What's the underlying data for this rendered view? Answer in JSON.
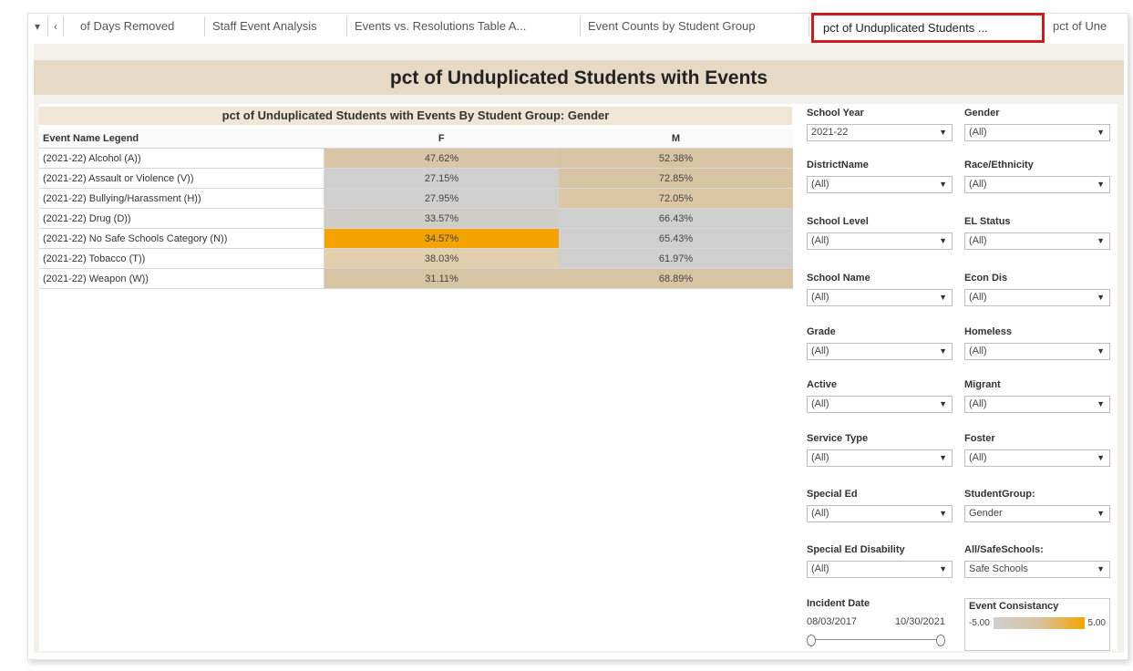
{
  "tabs": {
    "items": [
      {
        "label": "of Days Removed"
      },
      {
        "label": "Staff Event Analysis"
      },
      {
        "label": "Events vs. Resolutions Table A..."
      },
      {
        "label": "Event Counts by Student Group"
      },
      {
        "label": "pct of Unduplicated Students ..."
      },
      {
        "label": "pct of Une"
      }
    ],
    "active_index": 4
  },
  "dashboard": {
    "title": "pct of Unduplicated Students with Events"
  },
  "table": {
    "title": "pct of Unduplicated Students with Events By Student Group: Gender",
    "headers": [
      "Event Name Legend",
      "F",
      "M"
    ],
    "rows": [
      {
        "name": "(2021-22) Alcohol (A))",
        "f": "47.62%",
        "m": "52.38%"
      },
      {
        "name": "(2021-22) Assault or Violence (V))",
        "f": "27.15%",
        "m": "72.85%"
      },
      {
        "name": "(2021-22) Bullying/Harassment (H))",
        "f": "27.95%",
        "m": "72.05%"
      },
      {
        "name": "(2021-22) Drug (D))",
        "f": "33.57%",
        "m": "66.43%"
      },
      {
        "name": "(2021-22) No Safe Schools Category (N))",
        "f": "34.57%",
        "m": "65.43%"
      },
      {
        "name": "(2021-22) Tobacco (T))",
        "f": "38.03%",
        "m": "61.97%"
      },
      {
        "name": "(2021-22) Weapon (W))",
        "f": "31.11%",
        "m": "68.89%"
      }
    ],
    "colors": {
      "highlight": "#f4a300",
      "tan": "#d9c6a6",
      "grey": "#cfcfcf",
      "light_tan": "#e2cfae"
    }
  },
  "filters": {
    "school_year": {
      "label": "School Year",
      "value": "2021-22"
    },
    "gender": {
      "label": "Gender",
      "value": "(All)"
    },
    "district_name": {
      "label": "DistrictName",
      "value": "(All)"
    },
    "race_ethnicity": {
      "label": "Race/Ethnicity",
      "value": "(All)"
    },
    "school_level": {
      "label": "School Level",
      "value": "(All)"
    },
    "el_status": {
      "label": "EL Status",
      "value": "(All)"
    },
    "school_name": {
      "label": "School Name",
      "value": "(All)"
    },
    "econ_dis": {
      "label": "Econ Dis",
      "value": "(All)"
    },
    "grade": {
      "label": "Grade",
      "value": "(All)"
    },
    "homeless": {
      "label": "Homeless",
      "value": "(All)"
    },
    "active": {
      "label": "Active",
      "value": "(All)"
    },
    "migrant": {
      "label": "Migrant",
      "value": "(All)"
    },
    "service_type": {
      "label": "Service Type",
      "value": "(All)"
    },
    "foster": {
      "label": "Foster",
      "value": "(All)"
    },
    "special_ed": {
      "label": "Special Ed",
      "value": "(All)"
    },
    "student_group": {
      "label": "StudentGroup:",
      "value": "Gender"
    },
    "special_ed_disability": {
      "label": "Special Ed Disability",
      "value": "(All)"
    },
    "all_safe_schools": {
      "label": "All/SafeSchools:",
      "value": "Safe Schools"
    }
  },
  "incident_date": {
    "label": "Incident Date",
    "start": "08/03/2017",
    "end": "10/30/2021"
  },
  "event_consistancy": {
    "label": "Event Consistancy",
    "min": "-5.00",
    "max": "5.00"
  }
}
